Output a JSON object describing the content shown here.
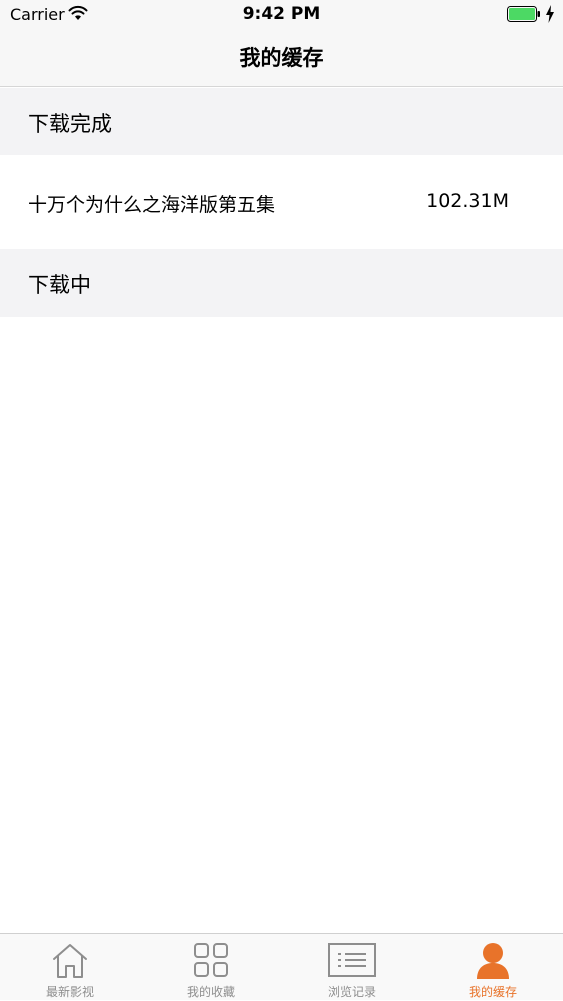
{
  "status_bar": {
    "carrier": "Carrier",
    "time": "9:42 PM",
    "wifi_icon": "wifi-icon",
    "battery_icon": "battery-icon",
    "charging_icon": "charging-bolt-icon"
  },
  "nav": {
    "title": "我的缓存"
  },
  "sections": {
    "completed": {
      "label": "下载完成",
      "items": [
        {
          "title": "十万个为什么之海洋版第五集",
          "size": "102.31M"
        }
      ]
    },
    "downloading": {
      "label": "下载中"
    }
  },
  "tab_bar": {
    "tabs": [
      {
        "label": "最新影视",
        "icon": "home-icon"
      },
      {
        "label": "我的收藏",
        "icon": "grid-icon"
      },
      {
        "label": "浏览记录",
        "icon": "list-icon"
      },
      {
        "label": "我的缓存",
        "icon": "person-icon",
        "active": true
      }
    ]
  },
  "colors": {
    "accent": "#e8732a",
    "inactive_tab": "#8e8e8e",
    "section_background": "#f3f3f5",
    "bar_background": "#f7f7f7",
    "battery": "#4cd964"
  }
}
